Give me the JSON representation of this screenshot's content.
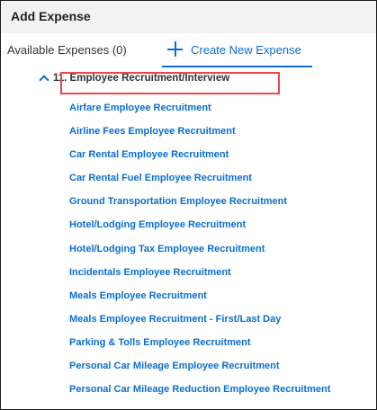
{
  "dialog": {
    "title": "Add Expense"
  },
  "tabs": {
    "available_label": "Available Expenses (0)",
    "create_label": "Create New Expense"
  },
  "group": {
    "label": "11. Employee Recruitment/Interview",
    "icon": "chevron-up-icon"
  },
  "expenses": [
    "Airfare Employee Recruitment",
    "Airline Fees Employee Recruitment",
    "Car Rental Employee Recruitment",
    "Car Rental Fuel Employee Recruitment",
    "Ground Transportation Employee Recruitment",
    "Hotel/Lodging Employee Recruitment",
    "Hotel/Lodging Tax Employee Recruitment",
    "Incidentals Employee Recruitment",
    "Meals Employee Recruitment",
    "Meals Employee Recruitment - First/Last Day",
    "Parking & Tolls Employee Recruitment",
    "Personal Car Mileage Employee Recruitment",
    "Personal Car Mileage Reduction Employee Recruitment"
  ],
  "colors": {
    "accent": "#0a6ed1",
    "highlight": "#e8474b",
    "header_bg": "#f2f2f2"
  }
}
